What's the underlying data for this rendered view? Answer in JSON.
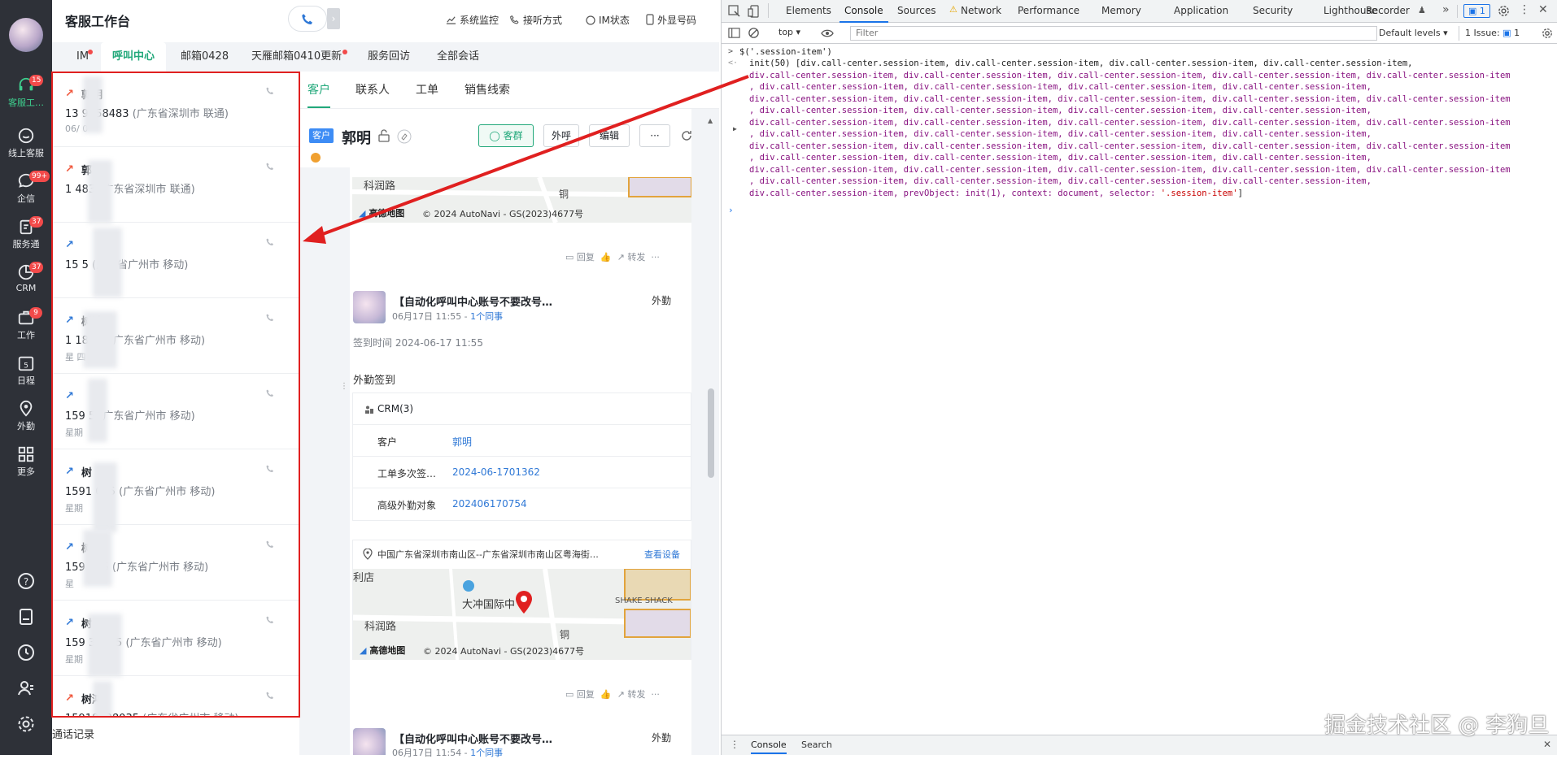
{
  "rail": {
    "items": [
      {
        "label": "客服工…",
        "badge": "15"
      },
      {
        "label": "线上客服",
        "badge": ""
      },
      {
        "label": "企信",
        "badge": "99+"
      },
      {
        "label": "服务通",
        "badge": "37"
      },
      {
        "label": "CRM",
        "badge": "37"
      },
      {
        "label": "工作",
        "badge": "9"
      },
      {
        "label": "日程",
        "badge": ""
      },
      {
        "label": "外勤",
        "badge": ""
      },
      {
        "label": "更多",
        "badge": ""
      }
    ]
  },
  "header": {
    "title": "客服工作台",
    "links": {
      "monitor": "系统监控",
      "listen": "接听方式",
      "im_status": "IM状态",
      "outbound": "外显号码"
    }
  },
  "tabs": [
    "IM",
    "呼叫中心",
    "邮箱0428",
    "天雁邮箱0410更新",
    "服务回访",
    "全部会话"
  ],
  "sessions": [
    {
      "name": "郭明",
      "phone": "13  9058483",
      "location": "(广东省深圳市 联通)",
      "time": "06/  0",
      "dir": "out",
      "arrow_color": "#f0553a"
    },
    {
      "name": "郭",
      "phone": "1    483",
      "location": "(广东省深圳市 联通)",
      "time": "",
      "dir": "out",
      "arrow_color": "#f0553a"
    },
    {
      "name": "",
      "phone": "15    5",
      "location": "(广东省广州市 移动)",
      "time": "",
      "dir": "in",
      "arrow_color": "#2f78d6"
    },
    {
      "name": "树鸿",
      "phone": "1 187  5",
      "location": "(广东省广州市 移动)",
      "time": "星  四",
      "dir": "in",
      "arrow_color": "#2f78d6"
    },
    {
      "name": "",
      "phone": "159    5",
      "location": "(广东省广州市 移动)",
      "time": "星期",
      "dir": "in",
      "arrow_color": "#2f78d6"
    },
    {
      "name": "树",
      "phone": "1591   035",
      "location": "(广东省广州市 移动)",
      "time": "星期",
      "dir": "in",
      "arrow_color": "#2f78d6"
    },
    {
      "name": "树",
      "phone": "159   035",
      "location": "(广东省广州市 移动)",
      "time": "星",
      "dir": "in",
      "arrow_color": "#2f78d6"
    },
    {
      "name": "树",
      "phone": "159  38035",
      "location": "(广东省广州市 移动)",
      "time": "星期",
      "dir": "in",
      "arrow_color": "#2f78d6"
    },
    {
      "name": "树鸿",
      "phone": "15918738035",
      "location": "(广东省广州市 移动)",
      "time": "",
      "dir": "out",
      "arrow_color": "#f0553a"
    }
  ],
  "call_log_label": "通话记录",
  "detail": {
    "tabs": [
      "客户",
      "联系人",
      "工单",
      "销售线索"
    ],
    "customer_tag": "客户",
    "customer_name": "郭明",
    "btn_group": "客群",
    "btn_call": "外呼",
    "btn_edit": "编辑",
    "btn_more": "···",
    "map_credit": "© 2024 AutoNavi - GS(2023)4677号",
    "map_brand": "高德地图",
    "map_label_road": "科润路",
    "map_label_tong": "铜",
    "actions": {
      "reply": "回复",
      "forward": "转发"
    },
    "post": {
      "title": "【自动化呼叫中心账号不要改号…",
      "tag": "外勤",
      "date": "06月17日 11:55 - ",
      "colleague": "1个同事",
      "checkin": "签到时间 2024-06-17 11:55",
      "type": "外勤签到"
    },
    "crm": {
      "title": "CRM(3)",
      "rows": [
        {
          "k": "客户",
          "v": "郭明"
        },
        {
          "k": "工单多次签…",
          "v": "2024-06-1701362"
        },
        {
          "k": "高级外勤对象",
          "v": "202406170754"
        }
      ]
    },
    "address": "中国广东省深圳市南山区--广东省深圳市南山区粤海街…",
    "view_device": "查看设备",
    "map2_labels": {
      "li": "利店",
      "center": "大冲国际中",
      "shake": "SHAKE SHACK",
      "road": "科润路"
    },
    "post2": {
      "title": "【自动化呼叫中心账号不要改号…",
      "tag": "外勤",
      "date": "06月17日 11:54 - ",
      "colleague": "1个同事"
    }
  },
  "devtools": {
    "tabs": [
      "Elements",
      "Console",
      "Sources",
      "Network",
      "Performance",
      "Memory",
      "Application",
      "Security",
      "Lighthouse",
      "Recorder"
    ],
    "issue_badge": "1",
    "context": "top",
    "filter_placeholder": "Filter",
    "levels": "Default levels",
    "issues": "1 Issue:",
    "issues_count": "1",
    "command": "$('.session-item')",
    "result_lines": [
      "init(50) [div.call-center.session-item, div.call-center.session-item, div.call-center.session-item, div.call-center.session-item,",
      "div.call-center.session-item, div.call-center.session-item, div.call-center.session-item, div.call-center.session-item, div.call-center.session-item",
      ", div.call-center.session-item, div.call-center.session-item, div.call-center.session-item, div.call-center.session-item,",
      "div.call-center.session-item, div.call-center.session-item, div.call-center.session-item, div.call-center.session-item, div.call-center.session-item",
      ", div.call-center.session-item, div.call-center.session-item, div.call-center.session-item, div.call-center.session-item,",
      "div.call-center.session-item, div.call-center.session-item, div.call-center.session-item, div.call-center.session-item, div.call-center.session-item",
      ", div.call-center.session-item, div.call-center.session-item, div.call-center.session-item, div.call-center.session-item,",
      "div.call-center.session-item, div.call-center.session-item, div.call-center.session-item, div.call-center.session-item, div.call-center.session-item",
      ", div.call-center.session-item, div.call-center.session-item, div.call-center.session-item, div.call-center.session-item,",
      "div.call-center.session-item, div.call-center.session-item, div.call-center.session-item, div.call-center.session-item, div.call-center.session-item",
      ", div.call-center.session-item, div.call-center.session-item, div.call-center.session-item, div.call-center.session-item,"
    ],
    "result_last_prefix": "div.call-center.session-item, ",
    "result_last_keys": "prevObject: init(1), context: document, selector: ",
    "result_last_selector": "'.session-item'",
    "drawer_tabs": [
      "Console",
      "Search"
    ]
  },
  "watermark": "掘金技术社区 @ 李狗旦"
}
